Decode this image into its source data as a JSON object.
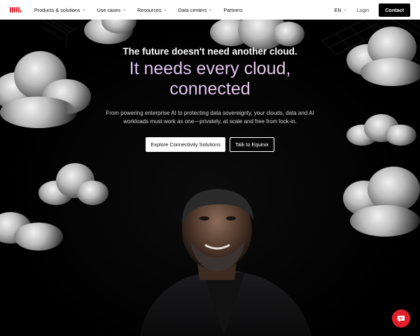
{
  "nav": {
    "logo_icon": "equinix-logo-icon",
    "brand_color": "#e0212b",
    "items": [
      {
        "label": "Products & solutions",
        "icon": "chevron-down-icon"
      },
      {
        "label": "Use cases",
        "icon": "chevron-down-icon"
      },
      {
        "label": "Resources",
        "icon": "chevron-down-icon"
      },
      {
        "label": "Data centers",
        "icon": "chevron-down-icon"
      },
      {
        "label": "Partners"
      }
    ],
    "language": "EN",
    "login": "Login",
    "contact": "Contact"
  },
  "hero": {
    "kicker": "The future doesn't need another cloud.",
    "headline_line1": "It needs every cloud,",
    "headline_line2": "connected",
    "subtext": "From powering enterprise AI to protecting data sovereignty, your clouds, data and AI workloads must work as one—privately, at scale and free from lock-in.",
    "cta_primary": "Explore Connectivity Solutions",
    "cta_secondary": "Talk to Equinix"
  },
  "chat": {
    "icon": "chat-bubble-icon",
    "color": "#e0212b"
  }
}
